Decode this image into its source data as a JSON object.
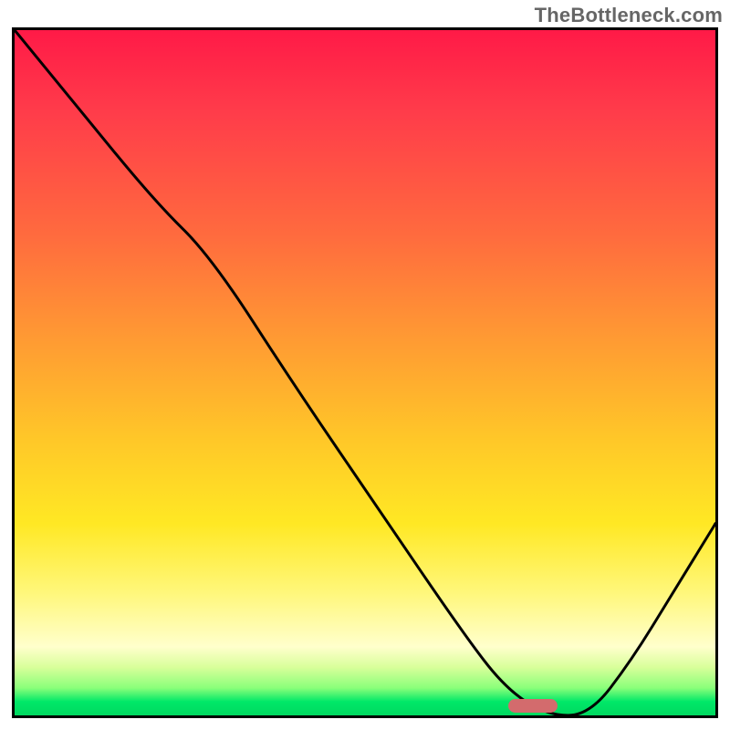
{
  "watermark": "TheBottleneck.com",
  "chart_data": {
    "type": "line",
    "title": "",
    "xlabel": "",
    "ylabel": "",
    "xlim": [
      0,
      100
    ],
    "ylim": [
      0,
      100
    ],
    "grid": false,
    "series": [
      {
        "name": "bottleneck-curve",
        "x": [
          0,
          8,
          20,
          28,
          40,
          52,
          64,
          70,
          76,
          82,
          88,
          94,
          100
        ],
        "values": [
          100,
          90,
          75,
          67,
          48,
          30,
          12,
          4,
          0,
          0,
          8,
          18,
          28
        ]
      }
    ],
    "annotations": [
      {
        "name": "optimal-zone",
        "x": 74,
        "width": 7,
        "y": 1.5,
        "color": "#d36b6d"
      }
    ],
    "background_gradient": [
      {
        "stop": 0.0,
        "color": "#ff1a47"
      },
      {
        "stop": 0.12,
        "color": "#ff3c4a"
      },
      {
        "stop": 0.3,
        "color": "#ff6b3e"
      },
      {
        "stop": 0.45,
        "color": "#ff9a33"
      },
      {
        "stop": 0.6,
        "color": "#ffc828"
      },
      {
        "stop": 0.72,
        "color": "#ffe824"
      },
      {
        "stop": 0.82,
        "color": "#fff77a"
      },
      {
        "stop": 0.9,
        "color": "#ffffcc"
      },
      {
        "stop": 0.93,
        "color": "#d8ff9a"
      },
      {
        "stop": 0.96,
        "color": "#8aff7a"
      },
      {
        "stop": 0.98,
        "color": "#00e868"
      },
      {
        "stop": 1.0,
        "color": "#00d860"
      }
    ]
  }
}
